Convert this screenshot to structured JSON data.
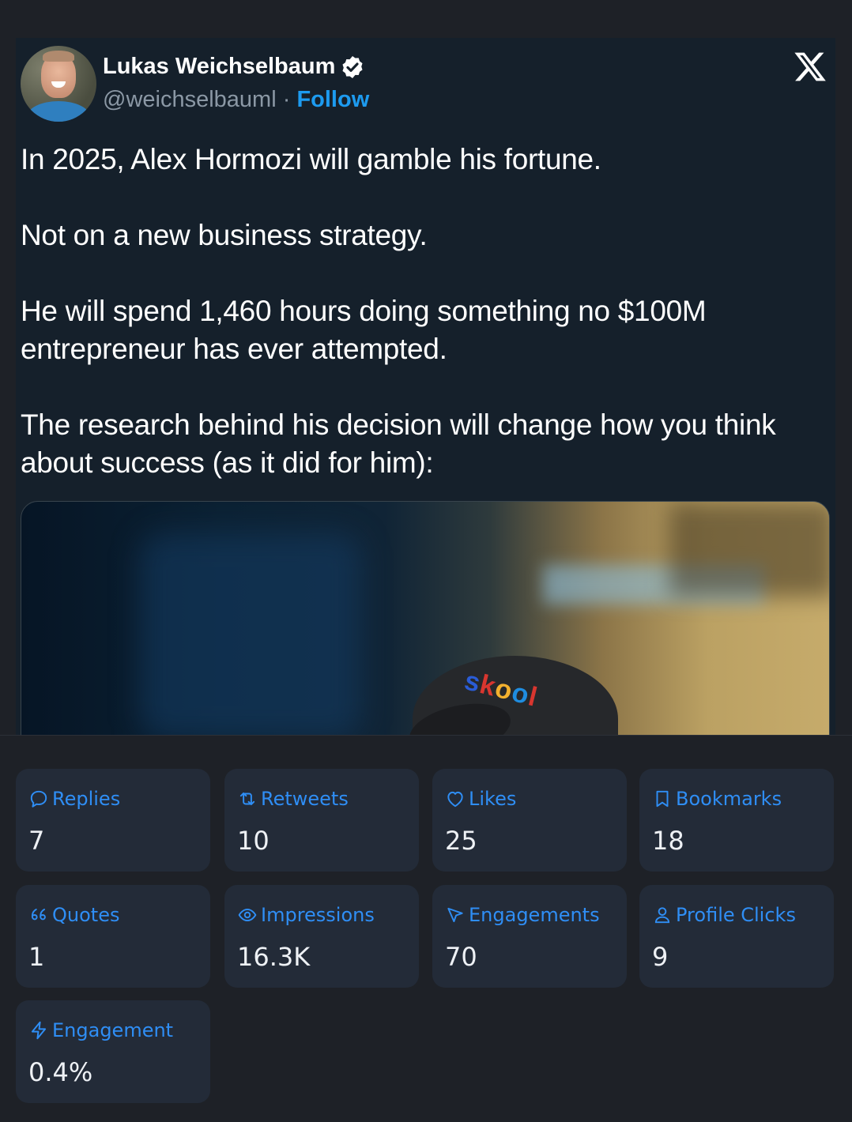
{
  "tweet": {
    "author_name": "Lukas Weichselbaum",
    "handle": "@weichselbauml",
    "separator": "·",
    "follow_label": "Follow",
    "text": "In 2025, Alex Hormozi will gamble his fortune.\n\nNot on a new business strategy.\n\nHe will spend 1,460 hours doing something no $100M entrepreneur has ever attempted.\n\nThe research behind his decision will change how you think about success (as it did for him):",
    "media_cap_text": [
      "s",
      "k",
      "o",
      "o",
      "l"
    ]
  },
  "stats": [
    {
      "label": "Replies",
      "value": "7",
      "icon": "reply-icon"
    },
    {
      "label": "Retweets",
      "value": "10",
      "icon": "retweet-icon"
    },
    {
      "label": "Likes",
      "value": "25",
      "icon": "heart-icon"
    },
    {
      "label": "Bookmarks",
      "value": "18",
      "icon": "bookmark-icon"
    },
    {
      "label": "Quotes",
      "value": "1",
      "icon": "quote-icon"
    },
    {
      "label": "Impressions",
      "value": "16.3K",
      "icon": "eye-icon"
    },
    {
      "label": "Engagements",
      "value": "70",
      "icon": "cursor-icon"
    },
    {
      "label": "Profile Clicks",
      "value": "9",
      "icon": "user-icon"
    },
    {
      "label": "Engagement",
      "value": "0.4%",
      "icon": "lightning-icon"
    }
  ],
  "colors": {
    "accent": "#1d9bf0",
    "stat_accent": "#2f8ef5",
    "card_bg": "#15202b",
    "stat_bg": "#232b38"
  }
}
